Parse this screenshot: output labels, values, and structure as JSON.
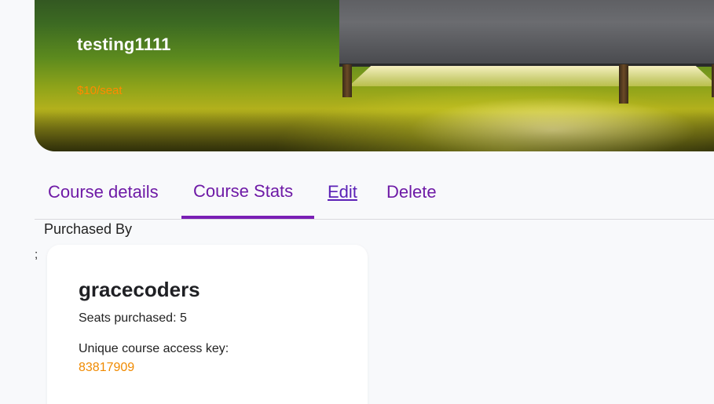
{
  "course": {
    "title": "testing1111",
    "price": "$10/seat"
  },
  "tabs": [
    {
      "label": "Course details",
      "active": false
    },
    {
      "label": "Course Stats",
      "active": true
    },
    {
      "label": "Edit",
      "active": false
    },
    {
      "label": "Delete",
      "active": false
    }
  ],
  "purchases": {
    "section_label": "Purchased By",
    "stray_text": ";",
    "cards": [
      {
        "name": "gracecoders",
        "seats_text": "Seats purchased: 5",
        "key_label": "Unique course access key:",
        "key_value": "83817909"
      }
    ]
  },
  "colors": {
    "accent_purple": "#6e1aa6",
    "price_orange": "#ff8a00",
    "key_orange": "#f08a00",
    "page_background": "#f8f9fb"
  }
}
